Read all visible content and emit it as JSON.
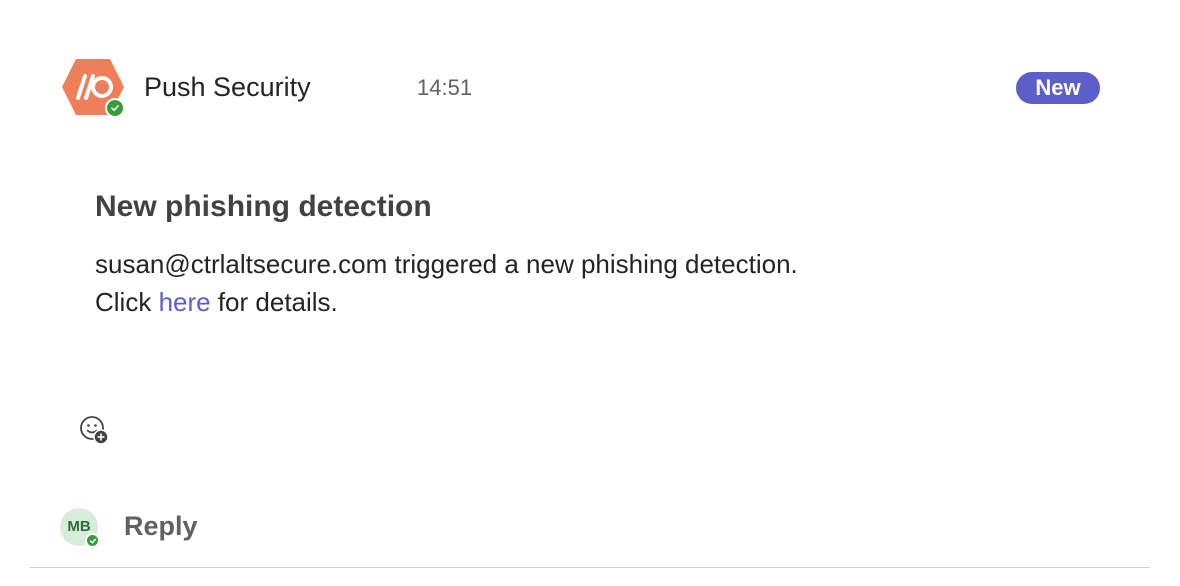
{
  "message": {
    "sender": "Push Security",
    "time": "14:51",
    "badge": "New",
    "title": "New phishing detection",
    "body_line1": "susan@ctrlaltsecure.com triggered a new phishing detection.",
    "body_line2_prefix": "Click ",
    "body_link": "here",
    "body_line2_suffix": " for details.",
    "logo_text": "//O"
  },
  "reply": {
    "avatar_initials": "MB",
    "label": "Reply"
  },
  "icons": {
    "sender_logo": "push-security-hexagon-logo",
    "presence": "available-check-icon",
    "reaction": "add-reaction-icon"
  },
  "colors": {
    "logo": "#ef7f5a",
    "presence": "#3a9b3a",
    "badge": "#5b5fc7",
    "link": "#5b5fc7",
    "reply_avatar_bg": "#d7ecd9"
  }
}
